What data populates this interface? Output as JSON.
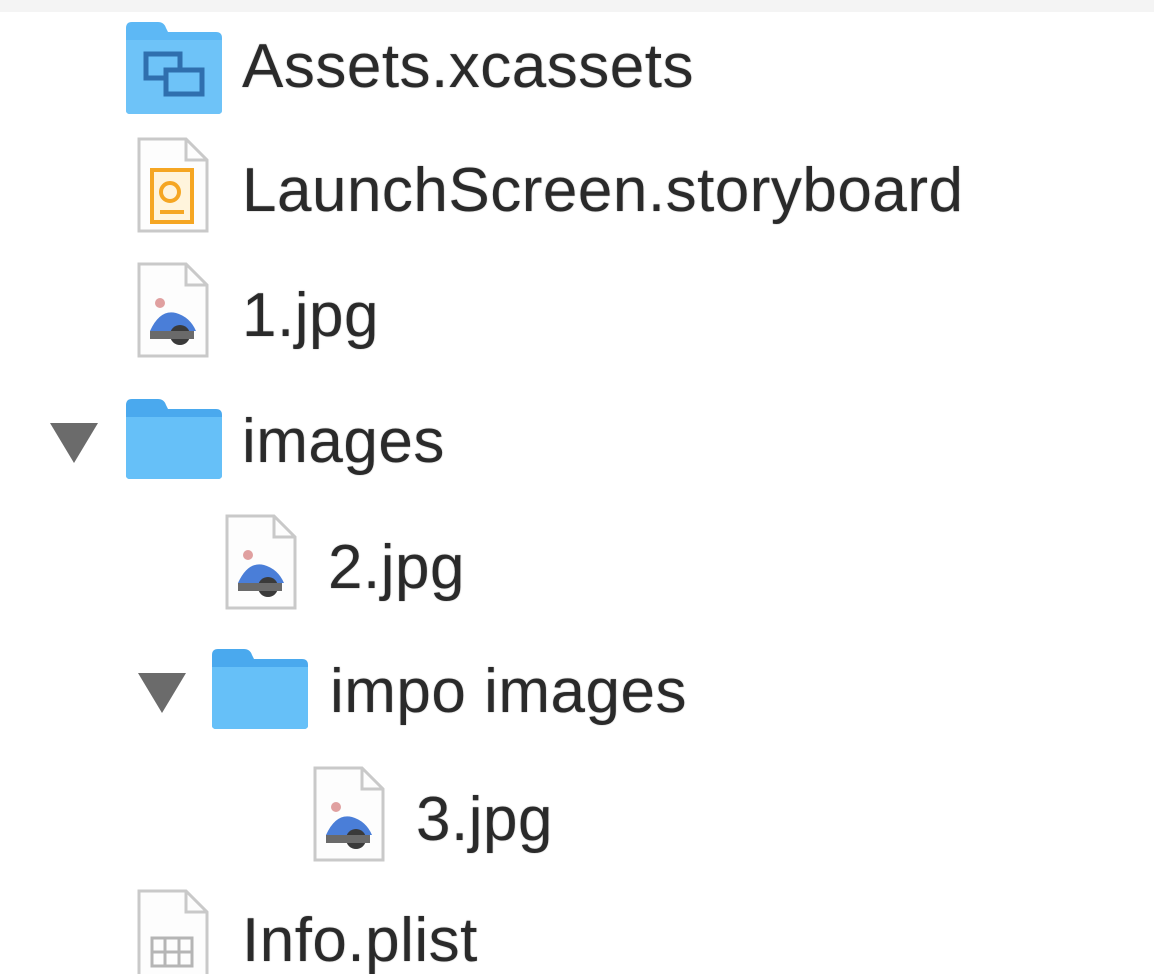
{
  "file_tree": {
    "items": [
      {
        "label": "Assets.xcassets",
        "icon": "asset-catalog-icon",
        "depth": 0,
        "expandable": false
      },
      {
        "label": "LaunchScreen.storyboard",
        "icon": "storyboard-file-icon",
        "depth": 0,
        "expandable": false
      },
      {
        "label": "1.jpg",
        "icon": "image-file-icon",
        "depth": 0,
        "expandable": false
      },
      {
        "label": "images",
        "icon": "folder-icon",
        "depth": 0,
        "expandable": true,
        "expanded": true
      },
      {
        "label": "2.jpg",
        "icon": "image-file-icon",
        "depth": 1,
        "expandable": false
      },
      {
        "label": "impo images",
        "icon": "folder-icon",
        "depth": 1,
        "expandable": true,
        "expanded": true
      },
      {
        "label": "3.jpg",
        "icon": "image-file-icon",
        "depth": 2,
        "expandable": false
      },
      {
        "label": "Info.plist",
        "icon": "plist-file-icon",
        "depth": 0,
        "expandable": false
      }
    ]
  },
  "colors": {
    "folder_blue": "#5db8f5",
    "folder_dark": "#3a9be3",
    "storyboard_orange": "#f5a623",
    "text": "#2a2a2a",
    "disclosure": "#6b6b6b"
  }
}
